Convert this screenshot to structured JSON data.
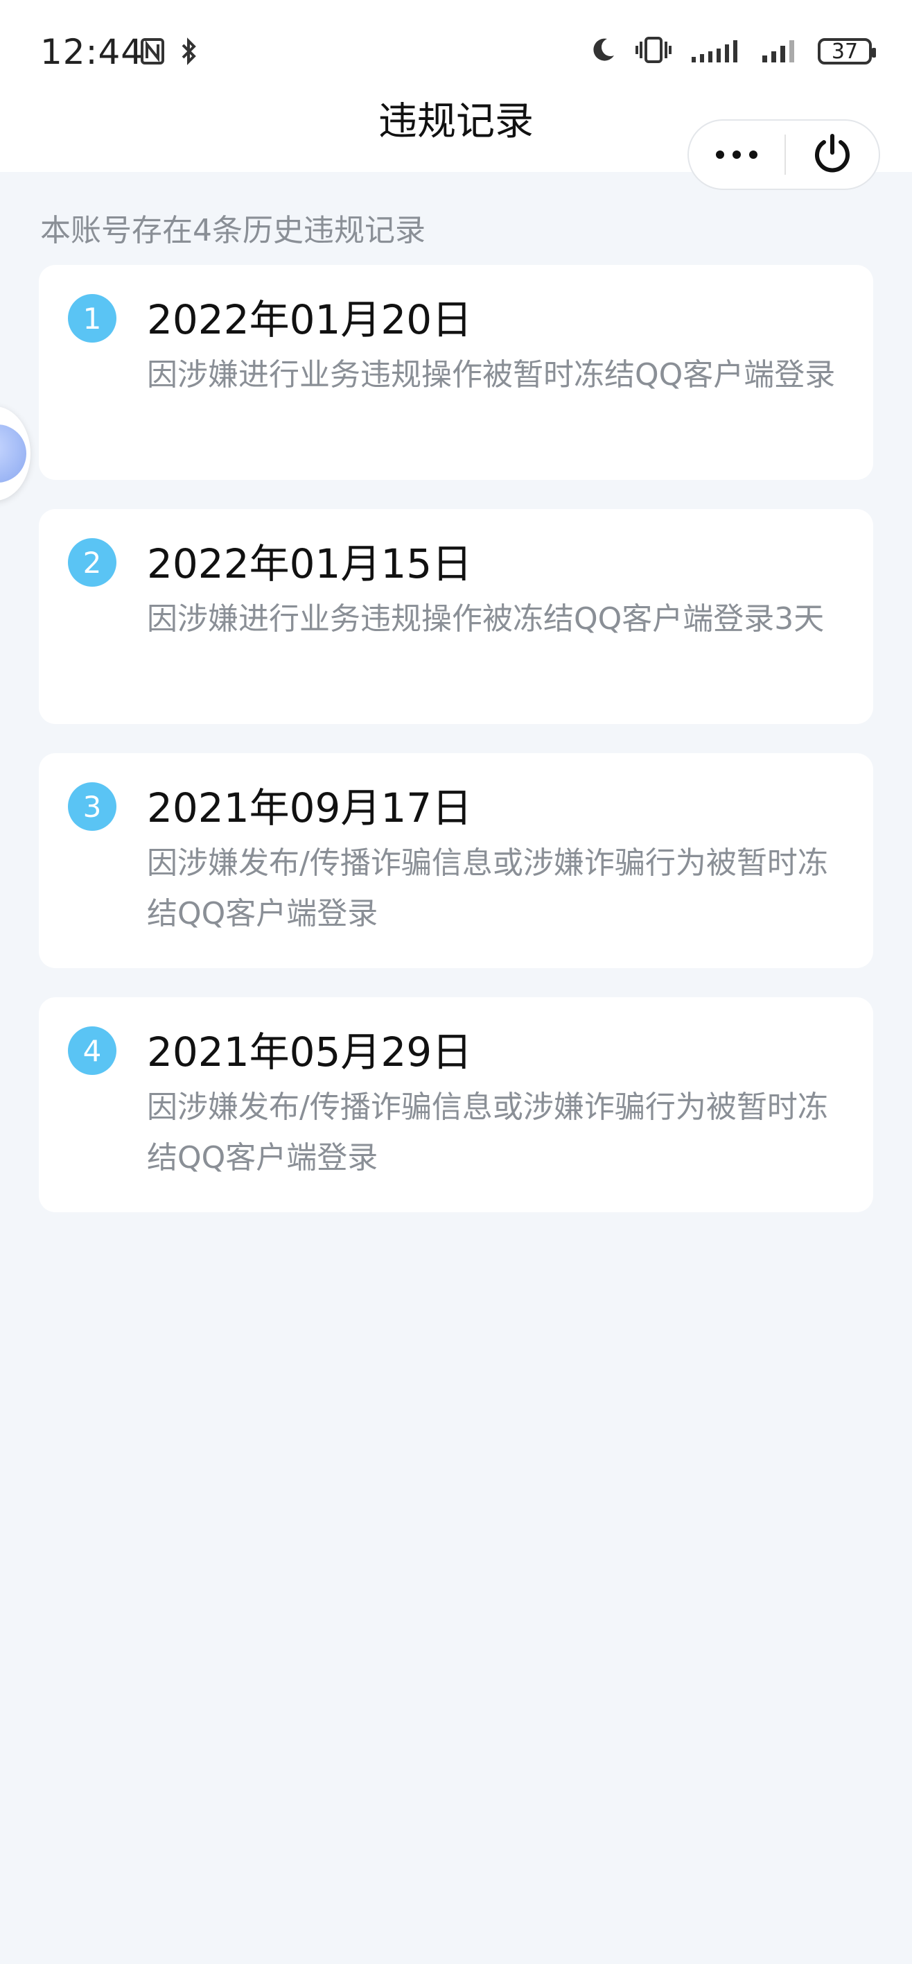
{
  "status_bar": {
    "time": "12:44",
    "battery": "37",
    "icons": [
      "nfc-icon",
      "bluetooth-icon",
      "moon-icon",
      "vibrate-icon",
      "signal-icon",
      "signal-icon"
    ]
  },
  "nav": {
    "title": "违规记录",
    "more_icon": "more-dots-icon",
    "close_icon": "power-icon"
  },
  "summary": "本账号存在4条历史违规记录",
  "records": [
    {
      "index": "1",
      "date": "2022年01月20日",
      "desc": "因涉嫌进行业务违规操作被暂时冻结QQ客户端登录"
    },
    {
      "index": "2",
      "date": "2022年01月15日",
      "desc": "因涉嫌进行业务违规操作被冻结QQ客户端登录3天"
    },
    {
      "index": "3",
      "date": "2021年09月17日",
      "desc": "因涉嫌发布/传播诈骗信息或涉嫌诈骗行为被暂时冻结QQ客户端登录"
    },
    {
      "index": "4",
      "date": "2021年05月29日",
      "desc": "因涉嫌发布/传播诈骗信息或涉嫌诈骗行为被暂时冻结QQ客户端登录"
    }
  ],
  "colors": {
    "badge": "#5ac4f4",
    "background": "#f3f6fa",
    "muted_text": "#8a8f96"
  }
}
